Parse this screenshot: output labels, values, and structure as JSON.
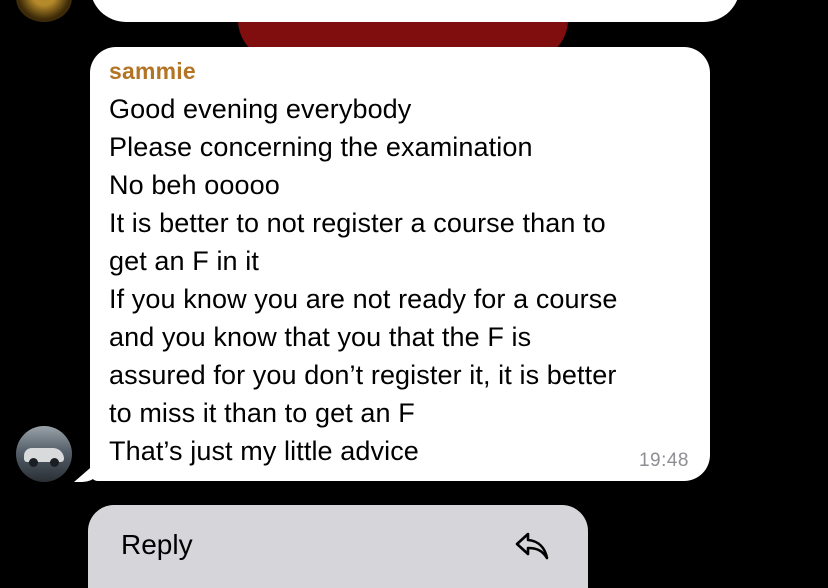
{
  "message": {
    "sender": "sammie",
    "lines": [
      "Good evening everybody",
      "Please concerning the examination",
      "No beh ooooo",
      "It is better to not register a course than to",
      "get an F in it",
      "If you know you are not ready for a course",
      "and you know that you that the F is",
      "assured for you don’t register it, it is better",
      "to miss it than to get an F",
      "That’s just my little advice"
    ],
    "time": "19:48"
  },
  "reply": {
    "label": "Reply",
    "icon": "reply-arrow-icon"
  },
  "colors": {
    "sender_name": "#b37425",
    "bubble": "#ffffff",
    "background": "#000000",
    "reply_bar": "#d6d5d9"
  }
}
